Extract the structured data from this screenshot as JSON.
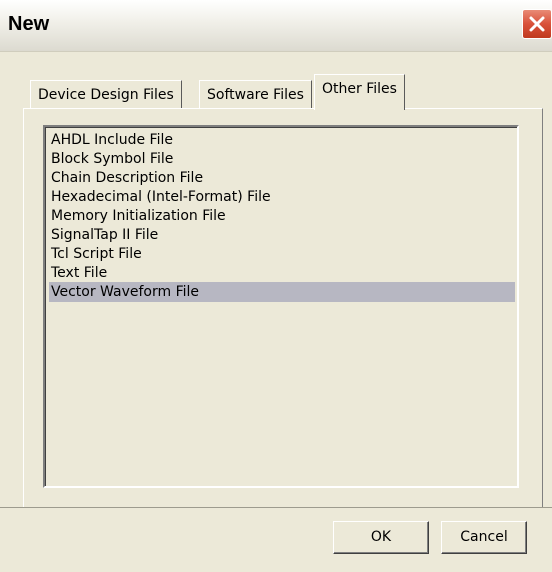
{
  "window": {
    "title": "New"
  },
  "tabs": [
    {
      "label": "Device Design Files",
      "active": false
    },
    {
      "label": "Software Files",
      "active": false
    },
    {
      "label": "Other Files",
      "active": true
    }
  ],
  "file_list": {
    "items": [
      {
        "label": "AHDL Include File",
        "selected": false
      },
      {
        "label": "Block Symbol File",
        "selected": false
      },
      {
        "label": "Chain Description File",
        "selected": false
      },
      {
        "label": "Hexadecimal (Intel-Format) File",
        "selected": false
      },
      {
        "label": "Memory Initialization File",
        "selected": false
      },
      {
        "label": "SignalTap II File",
        "selected": false
      },
      {
        "label": "Tcl Script File",
        "selected": false
      },
      {
        "label": "Text File",
        "selected": false
      },
      {
        "label": "Vector Waveform File",
        "selected": true
      }
    ]
  },
  "buttons": {
    "ok_label": "OK",
    "cancel_label": "Cancel"
  },
  "colors": {
    "selection": "#b7b7c2",
    "dialog_face": "#ece9d8",
    "close_button": "#d9513a"
  }
}
